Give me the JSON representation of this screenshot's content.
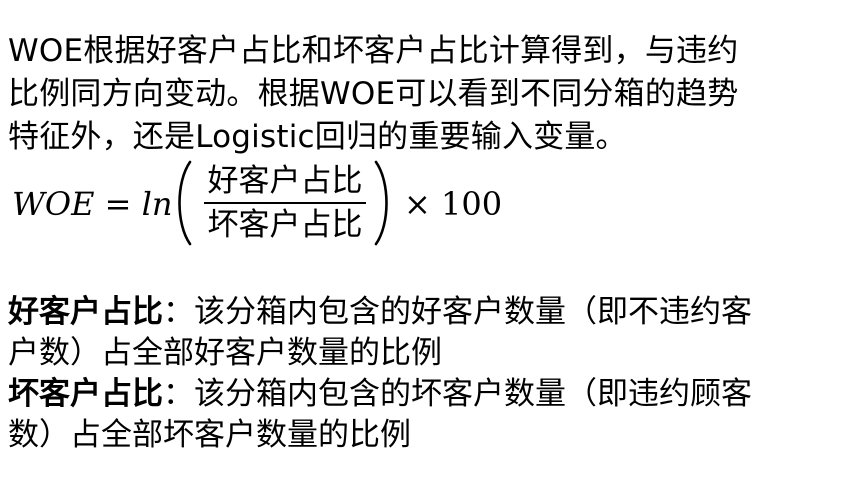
{
  "intro": {
    "lines": [
      "WOE根据好客户占比和坏客户占比计算得到，与违约",
      "比例同方向变动。根据WOE可以看到不同分箱的趋势",
      "特征外，还是Logistic回归的重要输入变量。"
    ]
  },
  "formula": {
    "lhs": "WOE = ln",
    "numerator": "好客户占比",
    "denominator": "坏客户占比",
    "rhs": "× 100"
  },
  "definitions": [
    {
      "term": "好客户占比",
      "line1_rest": "：该分箱内包含的好客户数量（即不违约客",
      "line2": "户数）占全部好客户数量的比例"
    },
    {
      "term": "坏客户占比",
      "line1_rest": "：该分箱内包含的坏客户数量（即违约顾客",
      "line2": "数）占全部坏客户数量的比例"
    }
  ]
}
